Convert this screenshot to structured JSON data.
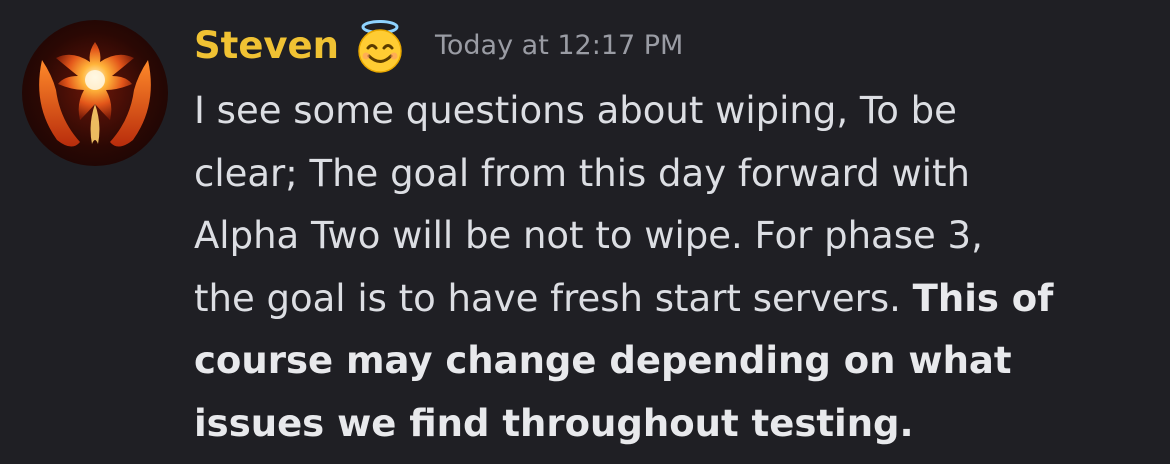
{
  "message": {
    "author": "Steven",
    "author_emoji": "halo-smiling-face-icon",
    "timestamp": "Today at 12:17 PM",
    "lines": [
      "I see some questions about wiping, To be",
      "clear; The goal from this day forward with",
      "Alpha Two will be not to wipe. For phase 3,",
      "the goal is to have fresh start servers."
    ],
    "line4_bold": "This of",
    "bold_lines": [
      "course may change depending on what",
      "issues we find throughout testing."
    ]
  },
  "colors": {
    "background": "#1f1f24",
    "username": "#f0c233",
    "timestamp": "#9a9ca4",
    "text": "#dcdee3"
  }
}
